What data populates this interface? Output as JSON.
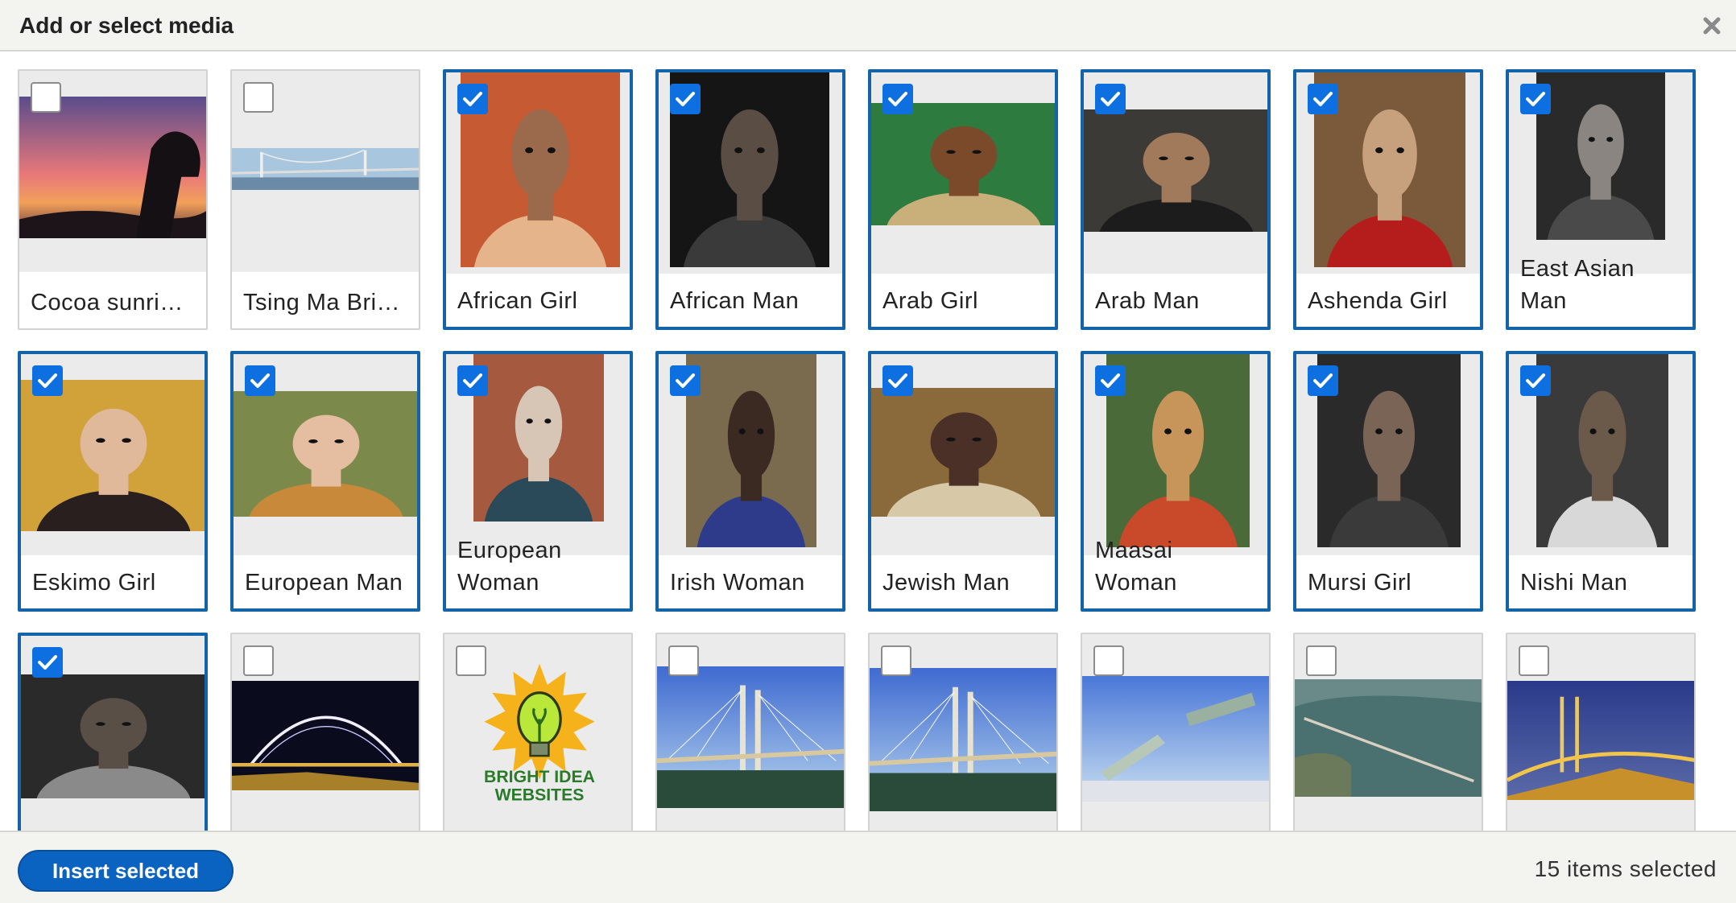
{
  "dialog": {
    "title": "Add or select media",
    "close_icon": "close-icon"
  },
  "media": [
    {
      "name": "Cocoa sunri…",
      "selected": false,
      "thumb": "sunset-landscape"
    },
    {
      "name": "Tsing Ma Bri…",
      "selected": false,
      "thumb": "bridge-panorama"
    },
    {
      "name": "African Girl",
      "selected": true,
      "thumb": "portrait"
    },
    {
      "name": "African Man",
      "selected": true,
      "thumb": "portrait"
    },
    {
      "name": "Arab Girl",
      "selected": true,
      "thumb": "portrait"
    },
    {
      "name": "Arab Man",
      "selected": true,
      "thumb": "portrait"
    },
    {
      "name": "Ashenda Girl",
      "selected": true,
      "thumb": "portrait"
    },
    {
      "name": "East Asian Man",
      "selected": true,
      "thumb": "portrait"
    },
    {
      "name": "Eskimo Girl",
      "selected": true,
      "thumb": "portrait"
    },
    {
      "name": "European Man",
      "selected": true,
      "thumb": "portrait"
    },
    {
      "name": "European Woman",
      "selected": true,
      "thumb": "portrait"
    },
    {
      "name": "Irish Woman",
      "selected": true,
      "thumb": "portrait"
    },
    {
      "name": "Jewish Man",
      "selected": true,
      "thumb": "portrait"
    },
    {
      "name": "Maasai Woman",
      "selected": true,
      "thumb": "portrait"
    },
    {
      "name": "Mursi Girl",
      "selected": true,
      "thumb": "portrait"
    },
    {
      "name": "Nishi Man",
      "selected": true,
      "thumb": "portrait"
    },
    {
      "name": "",
      "selected": true,
      "thumb": "portrait"
    },
    {
      "name": "",
      "selected": false,
      "thumb": "arch-bridge-night"
    },
    {
      "name": "",
      "selected": false,
      "thumb": "logo",
      "logo_text": [
        "BRIGHT IDEA",
        "WEBSITES"
      ]
    },
    {
      "name": "",
      "selected": false,
      "thumb": "cable-bridge"
    },
    {
      "name": "",
      "selected": false,
      "thumb": "cable-bridge"
    },
    {
      "name": "",
      "selected": false,
      "thumb": "bridge-construction"
    },
    {
      "name": "",
      "selected": false,
      "thumb": "bridge-aerial"
    },
    {
      "name": "",
      "selected": false,
      "thumb": "bridge-night-aerial"
    }
  ],
  "footer": {
    "insert_label": "Insert selected",
    "selected_count": "15 items selected"
  },
  "colors": {
    "accent": "#1364a8",
    "checkbox": "#0e6fe0",
    "button": "#0b63c1"
  }
}
